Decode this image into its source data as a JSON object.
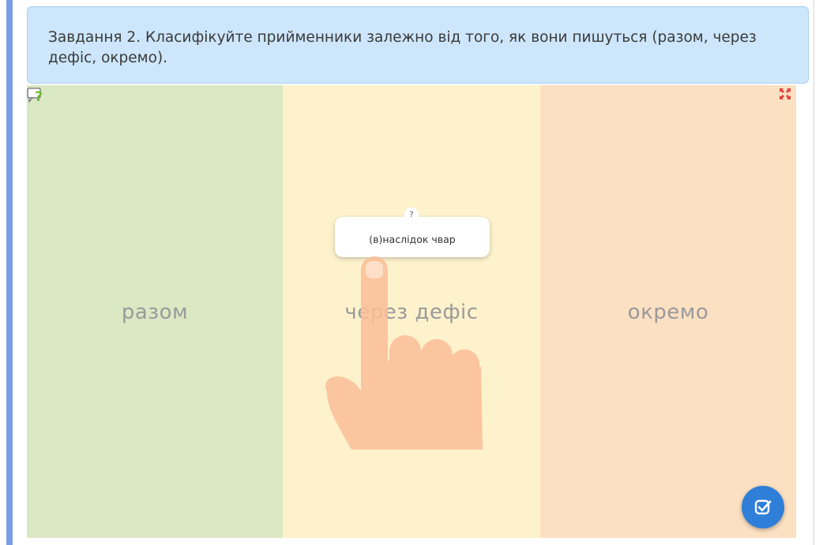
{
  "task": {
    "text": "Завдання 2. Класифікуйте прийменники залежно від того, як вони пишуться (разом, через дефіс, окремо)."
  },
  "game": {
    "columns": [
      {
        "label": "разом",
        "color": "#dbe8c4"
      },
      {
        "label": "через дефіс",
        "color": "#fdf2cc"
      },
      {
        "label": "окремо",
        "color": "#fce0c2"
      }
    ],
    "card": {
      "text": "(в)наслідок чвар",
      "help_mark": "?"
    },
    "icons": {
      "help": "help-question-icon",
      "fullscreen": "fullscreen-icon",
      "check": "check-icon",
      "hand": "hand-pointer-icon"
    },
    "colors": {
      "accent": "#2f7fd8",
      "banner": "#cde6fb",
      "rail": "#7b9ee6",
      "hand": "#fbbf9a"
    }
  }
}
